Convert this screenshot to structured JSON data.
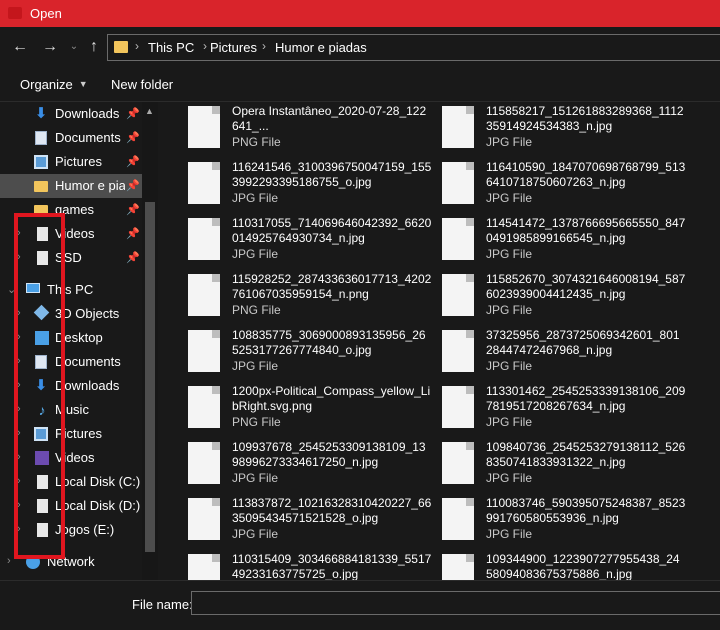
{
  "window": {
    "title": "Open"
  },
  "address": {
    "crumbs": [
      "This PC",
      "Pictures",
      "Humor e piadas"
    ]
  },
  "toolbar": {
    "organize": "Organize",
    "new_folder": "New folder"
  },
  "sidebar": {
    "items": [
      {
        "label": "Downloads",
        "icon": "download-icon",
        "pinned": true
      },
      {
        "label": "Documents",
        "icon": "documents-icon",
        "pinned": true
      },
      {
        "label": "Pictures",
        "icon": "pictures-icon",
        "pinned": true
      },
      {
        "label": "Humor e piadas",
        "icon": "folder-icon",
        "pinned": true,
        "selected": true
      },
      {
        "label": "games",
        "icon": "folder-icon",
        "pinned": true
      },
      {
        "label": "Videos",
        "icon": "file-icon",
        "pinned": true
      },
      {
        "label": "SSD",
        "icon": "file-icon",
        "pinned": true
      },
      {
        "label": "This PC",
        "icon": "this-pc-icon",
        "expanded": true
      },
      {
        "label": "3D Objects",
        "icon": "3d-objects-icon"
      },
      {
        "label": "Desktop",
        "icon": "desktop-icon"
      },
      {
        "label": "Documents",
        "icon": "documents-icon"
      },
      {
        "label": "Downloads",
        "icon": "download-icon"
      },
      {
        "label": "Music",
        "icon": "music-icon"
      },
      {
        "label": "Pictures",
        "icon": "pictures-icon"
      },
      {
        "label": "Videos",
        "icon": "videos-icon"
      },
      {
        "label": "Local Disk (C:)",
        "icon": "file-icon"
      },
      {
        "label": "Local Disk (D:)",
        "icon": "file-icon"
      },
      {
        "label": "Jogos (E:)",
        "icon": "file-icon"
      },
      {
        "label": "Network",
        "icon": "network-icon"
      }
    ]
  },
  "files": [
    {
      "name": "Opera Instantâneo_2020-07-28_122641_...",
      "type": "PNG File"
    },
    {
      "name": "115858217_151261883289368_111235914924534383_n.jpg",
      "type": "JPG File"
    },
    {
      "name": "116241546_3100396750047159_1553992293395186755_o.jpg",
      "type": "JPG File"
    },
    {
      "name": "116410590_1847070698768799_5136410718750607263_n.jpg",
      "type": "JPG File"
    },
    {
      "name": "110317055_714069646042392_6620014925764930734_n.jpg",
      "type": "JPG File"
    },
    {
      "name": "114541472_1378766695665550_8470491985899166545_n.jpg",
      "type": "JPG File"
    },
    {
      "name": "115928252_287433636017713_4202761067035959154_n.png",
      "type": "PNG File"
    },
    {
      "name": "115852670_3074321646008194_5876023939004412435_n.jpg",
      "type": "JPG File"
    },
    {
      "name": "108835775_3069000893135956_265253177267774840_o.jpg",
      "type": "JPG File"
    },
    {
      "name": "37325956_2873725069342601_80128447472467968_n.jpg",
      "type": "JPG File"
    },
    {
      "name": "1200px-Political_Compass_yellow_LibRight.svg.png",
      "type": "PNG File"
    },
    {
      "name": "113301462_2545253339138106_2097819517208267634_n.jpg",
      "type": "JPG File"
    },
    {
      "name": "109937678_2545253309138109_1398996273334617250_n.jpg",
      "type": "JPG File"
    },
    {
      "name": "109840736_2545253279138112_5268350741833931322_n.jpg",
      "type": "JPG File"
    },
    {
      "name": "113837872_10216328310420227_6635095434571521528_o.jpg",
      "type": "JPG File"
    },
    {
      "name": "110083746_590395075248387_8523991760580553936_n.jpg",
      "type": "JPG File"
    },
    {
      "name": "110315409_303466884181339_551749233163775725_o.jpg",
      "type": "JPG File"
    },
    {
      "name": "109344900_1223907277955438_2458094083675375886_n.jpg",
      "type": "JPG File"
    }
  ],
  "footer": {
    "file_name_label": "File name:",
    "file_name_value": ""
  },
  "colors": {
    "titlebar": "#d9242b",
    "background": "#191919",
    "selected": "#4d4d4d",
    "annotation_box": "#e0161f"
  }
}
